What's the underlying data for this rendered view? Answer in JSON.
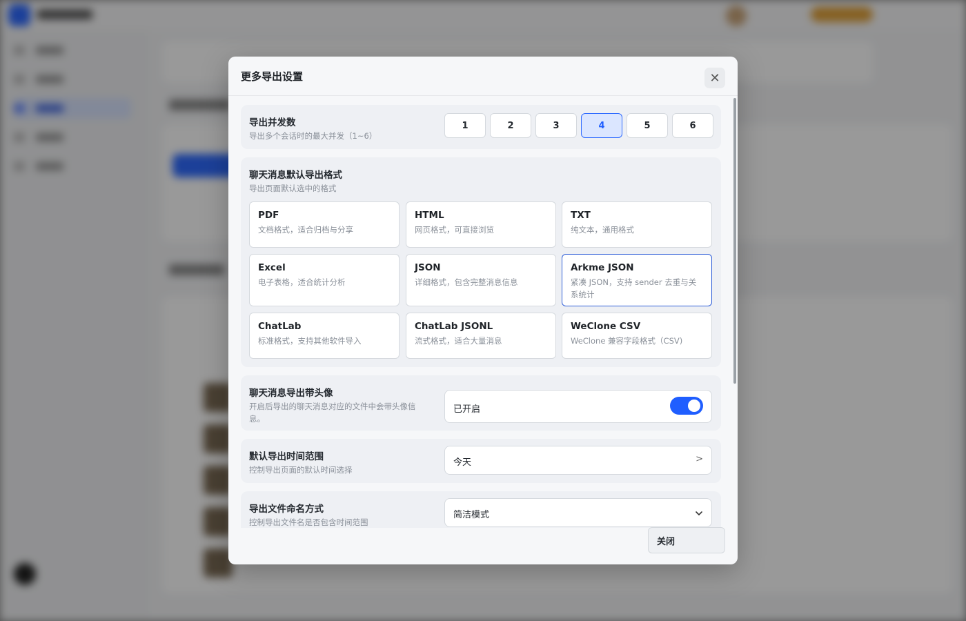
{
  "modal": {
    "title": "更多导出设置",
    "close_label": "关闭"
  },
  "concurrency": {
    "title": "导出并发数",
    "desc": "导出多个会话时的最大并发（1~6）",
    "options": [
      "1",
      "2",
      "3",
      "4",
      "5",
      "6"
    ],
    "selected": "4"
  },
  "format": {
    "title": "聊天消息默认导出格式",
    "desc": "导出页面默认选中的格式",
    "options": [
      {
        "name": "PDF",
        "desc": "文档格式，适合归档与分享"
      },
      {
        "name": "HTML",
        "desc": "网页格式，可直接浏览"
      },
      {
        "name": "TXT",
        "desc": "纯文本，通用格式"
      },
      {
        "name": "Excel",
        "desc": "电子表格，适合统计分析"
      },
      {
        "name": "JSON",
        "desc": "详细格式，包含完整消息信息"
      },
      {
        "name": "Arkme JSON",
        "desc": "紧凑 JSON，支持 sender 去重与关系统计"
      },
      {
        "name": "ChatLab",
        "desc": "标准格式，支持其他软件导入"
      },
      {
        "name": "ChatLab JSONL",
        "desc": "流式格式，适合大量消息"
      },
      {
        "name": "WeClone CSV",
        "desc": "WeClone 兼容字段格式（CSV)"
      }
    ],
    "selected": "Arkme JSON"
  },
  "avatar": {
    "title": "聊天消息导出带头像",
    "desc": "开启后导出的聊天消息对应的文件中会带头像信息。",
    "status": "已开启",
    "enabled": true
  },
  "time_range": {
    "title": "默认导出时间范围",
    "desc": "控制导出页面的默认时间选择",
    "value": "今天",
    "arrow": ">"
  },
  "naming": {
    "title": "导出文件命名方式",
    "desc": "控制导出文件名是否包含时间范围",
    "value": "简洁模式"
  },
  "colors": {
    "accent": "#1f5eff",
    "selected_bg": "#dbe6ff"
  }
}
